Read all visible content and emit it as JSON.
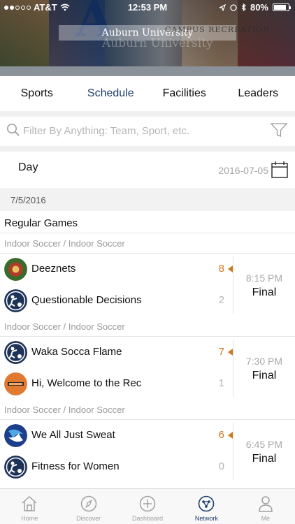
{
  "status_bar": {
    "carrier": "AT&T",
    "time": "12:53 PM",
    "battery": "80%"
  },
  "banner": {
    "title": "Auburn University",
    "subtitle": "CAMPUS RECREATION",
    "ghost_text": "Auburn University"
  },
  "tabs": [
    {
      "label": "Sports",
      "active": false
    },
    {
      "label": "Schedule",
      "active": true
    },
    {
      "label": "Facilities",
      "active": false
    },
    {
      "label": "Leaders",
      "active": false
    }
  ],
  "search": {
    "placeholder": "Filter By Anything: Team, Sport, etc.",
    "value": ""
  },
  "day_selector": {
    "mode": "Day",
    "date": "2016-07-05"
  },
  "schedule": {
    "date_header": "7/5/2016",
    "group_title": "Regular Games",
    "matches": [
      {
        "sport": "Indoor Soccer / Indoor Soccer",
        "home": {
          "name": "Deeznets",
          "score": "8",
          "winner": true,
          "logo": "red-flower-logo"
        },
        "away": {
          "name": "Questionable Decisions",
          "score": "2",
          "winner": false,
          "logo": "soccer-player-logo"
        },
        "time": "8:15 PM",
        "status": "Final"
      },
      {
        "sport": "Indoor Soccer / Indoor Soccer",
        "home": {
          "name": "Waka Socca Flame",
          "score": "7",
          "winner": true,
          "logo": "soccer-player-logo"
        },
        "away": {
          "name": "Hi, Welcome to the Rec",
          "score": "1",
          "winner": false,
          "logo": "orange-rec-logo"
        },
        "time": "7:30 PM",
        "status": "Final"
      },
      {
        "sport": "Indoor Soccer / Indoor Soccer",
        "home": {
          "name": "We All Just Sweat",
          "score": "6",
          "winner": true,
          "logo": "blue-swirl-logo"
        },
        "away": {
          "name": "Fitness for Women",
          "score": "0",
          "winner": false,
          "logo": "soccer-player-logo"
        },
        "time": "6:45 PM",
        "status": "Final"
      }
    ]
  },
  "bottom_nav": [
    {
      "label": "Home",
      "icon": "home-icon",
      "active": false
    },
    {
      "label": "Discover",
      "icon": "compass-icon",
      "active": false
    },
    {
      "label": "Dashboard",
      "icon": "plus-circle-icon",
      "active": false
    },
    {
      "label": "Network",
      "icon": "network-icon",
      "active": true
    },
    {
      "label": "Me",
      "icon": "person-icon",
      "active": false
    }
  ],
  "colors": {
    "accent": "#1d3c6b",
    "winner": "#d2771f",
    "muted": "#a8a8a8"
  }
}
